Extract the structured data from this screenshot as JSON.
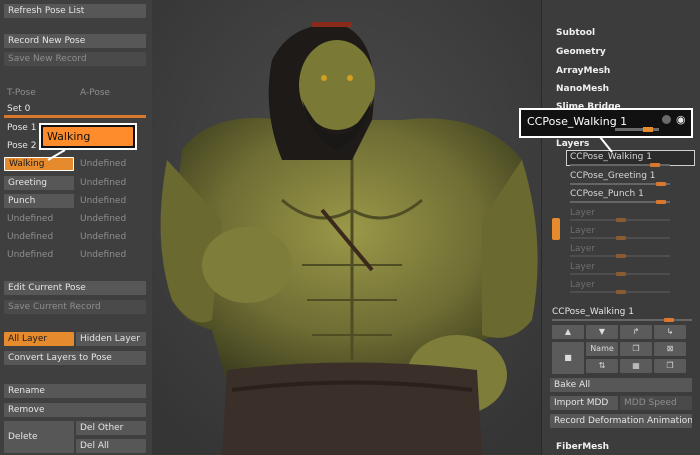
{
  "left_panel": {
    "refresh_pose_list": "Refresh Pose List",
    "record_new_pose": "Record New Pose",
    "save_new_record": "Save New Record",
    "t_pose": "T-Pose",
    "a_pose": "A-Pose",
    "set_label": "Set 0",
    "pose1": "Pose 1",
    "pose2": "Pose 2",
    "walking": "Walking",
    "greeting": "Greeting",
    "punch": "Punch",
    "undefined": "Undefined",
    "edit_current_pose": "Edit Current Pose",
    "save_current_record": "Save Current Record",
    "all_layer": "All Layer",
    "hidden_layer": "Hidden Layer",
    "convert_layers": "Convert Layers to Pose",
    "rename": "Rename",
    "remove": "Remove",
    "delete": "Delete",
    "del_other": "Del Other",
    "del_all": "Del All"
  },
  "callouts": {
    "walking": "Walking",
    "ccpose": "CCPose_Walking 1"
  },
  "right_panel": {
    "menu": [
      "Subtool",
      "Geometry",
      "ArrayMesh",
      "NanoMesh",
      "Slime Bridge"
    ],
    "layers_title": "Layers",
    "layers": [
      "CCPose_Walking 1",
      "CCPose_Greeting 1",
      "CCPose_Punch 1"
    ],
    "empty_layer": "Layer",
    "current_layer": "CCPose_Walking 1",
    "name_icon": "Name",
    "bake_all": "Bake All",
    "import_mdd": "Import MDD",
    "mdd_speed": "MDD Speed",
    "record_deformation": "Record Deformation Animation",
    "fibermesh": "FiberMesh"
  },
  "colors": {
    "accent": "#e68a2e",
    "panel": "#3f3f3f",
    "button": "#575757"
  }
}
